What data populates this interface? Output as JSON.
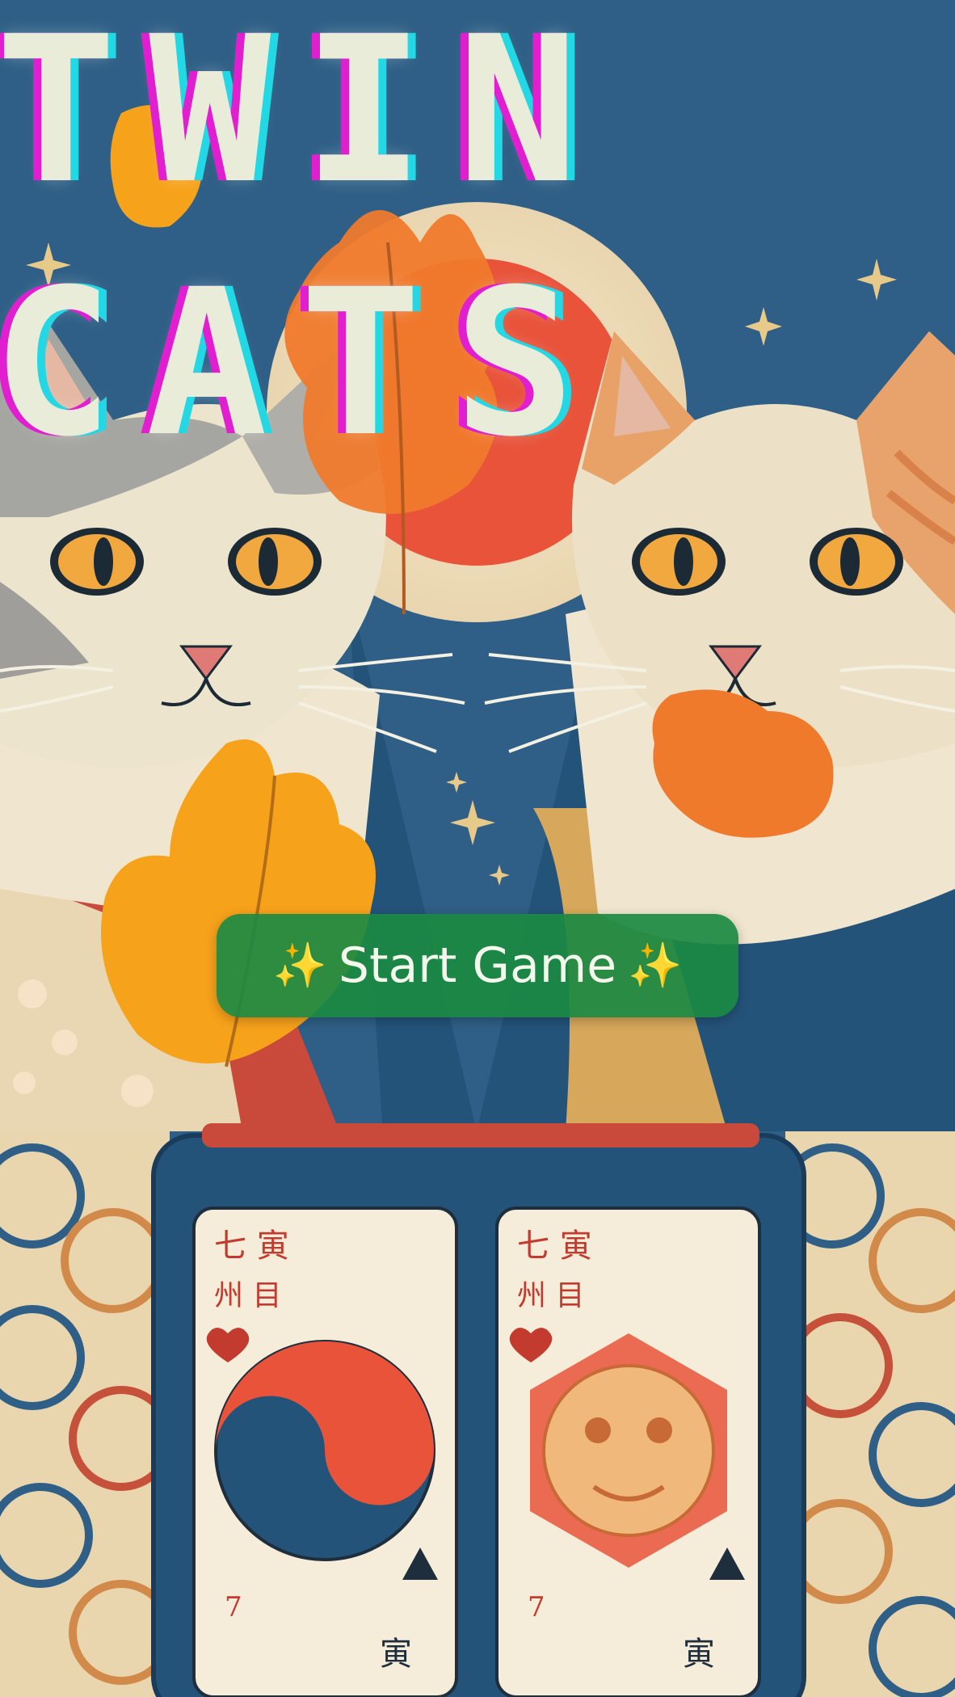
{
  "title": {
    "line1": "TWIN",
    "line2": "CATS"
  },
  "start_button": {
    "label": "Start Game",
    "icon_left": "✨",
    "icon_right": "✨"
  },
  "cards": [
    {
      "corner_top": "七 寅",
      "corner_sub": "州 目",
      "suit_top": "heart",
      "suit_bottom": "spade",
      "corner_bottom": "寅",
      "mark_bottom": "7"
    },
    {
      "corner_top": "七 寅",
      "corner_sub": "州 目",
      "suit_top": "heart",
      "suit_bottom": "spade",
      "corner_bottom": "寅",
      "mark_bottom": "7"
    }
  ],
  "colors": {
    "background": "#2f5f86",
    "title_fill": "#e9ecd9",
    "title_glitch_magenta": "#e21fd0",
    "title_glitch_cyan": "#23d8e5",
    "button_green": "#1b8a42",
    "sun": "#e8533a",
    "leaf_orange": "#f08a2c",
    "leaf_yellow": "#f7a21b"
  }
}
